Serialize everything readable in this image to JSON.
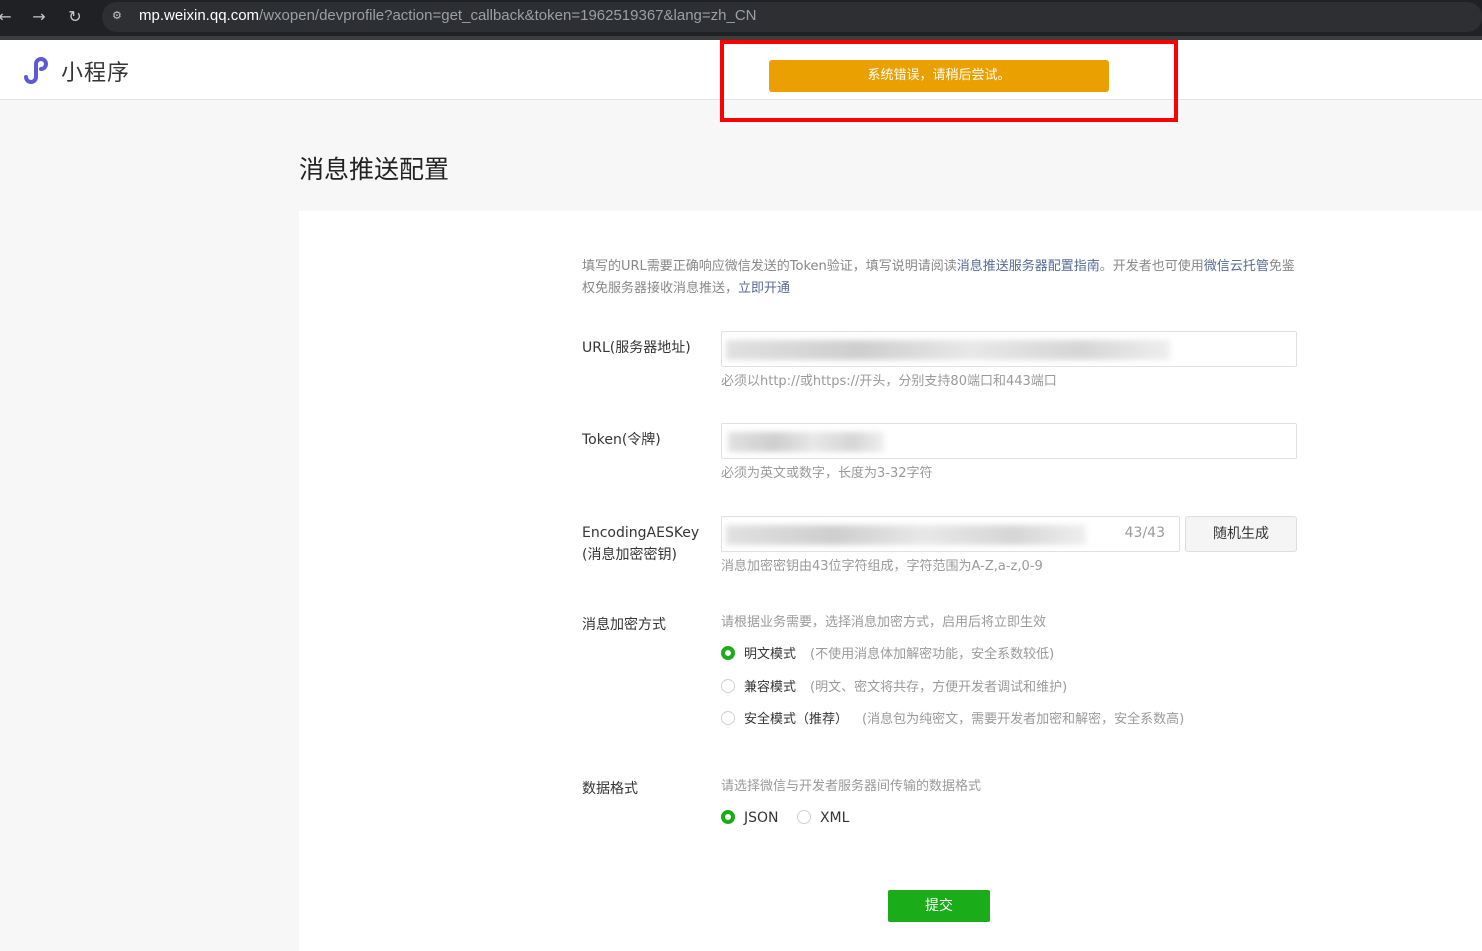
{
  "browser": {
    "back_icon": "←",
    "forward_icon": "→",
    "reload_icon": "↻",
    "url_host": "mp.weixin.qq.com",
    "url_path": "/wxopen/devprofile?action=get_callback&token=1962519367&lang=zh_CN"
  },
  "header": {
    "app_name": "小程序",
    "toast": "系统错误，请稍后尝试。",
    "logo_color": "#5d5bd4"
  },
  "page": {
    "title": "消息推送配置",
    "tip": {
      "text1": "填写的URL需要正确响应微信发送的Token验证，填写说明请阅读",
      "link1": "消息推送服务器配置指南",
      "text2": "。开发者也可使用",
      "link2": "微信云托管",
      "text3": "免鉴权免服务器接收消息推送，",
      "link3": "立即开通"
    },
    "url_field": {
      "label": "URL(服务器地址)",
      "desc": "必须以http://或https://开头，分别支持80端口和443端口"
    },
    "token_field": {
      "label": "Token(令牌)",
      "desc": "必须为英文或数字，长度为3-32字符"
    },
    "aes_field": {
      "label_line1": "EncodingAESKey",
      "label_line2": "(消息加密密钥)",
      "counter": "43/43",
      "generate_button": "随机生成",
      "desc": "消息加密密钥由43位字符组成，字符范围为A-Z,a-z,0-9"
    },
    "encrypt_mode": {
      "label": "消息加密方式",
      "desc": "请根据业务需要，选择消息加密方式，启用后将立即生效",
      "options": [
        {
          "label": "明文模式",
          "note": "(不使用消息体加解密功能，安全系数较低)",
          "selected": true
        },
        {
          "label": "兼容模式",
          "note": "(明文、密文将共存，方便开发者调试和维护)",
          "selected": false
        },
        {
          "label": "安全模式（推荐）",
          "note": "(消息包为纯密文，需要开发者加密和解密，安全系数高)",
          "selected": false
        }
      ]
    },
    "data_format": {
      "label": "数据格式",
      "desc": "请选择微信与开发者服务器间传输的数据格式",
      "options": [
        {
          "label": "JSON",
          "selected": true
        },
        {
          "label": "XML",
          "selected": false
        }
      ]
    },
    "submit_button": "提交"
  },
  "colors": {
    "toast_bg": "#eaa000",
    "highlight_border": "#ff0000",
    "primary_green": "#1aad19",
    "link": "#576b95"
  }
}
